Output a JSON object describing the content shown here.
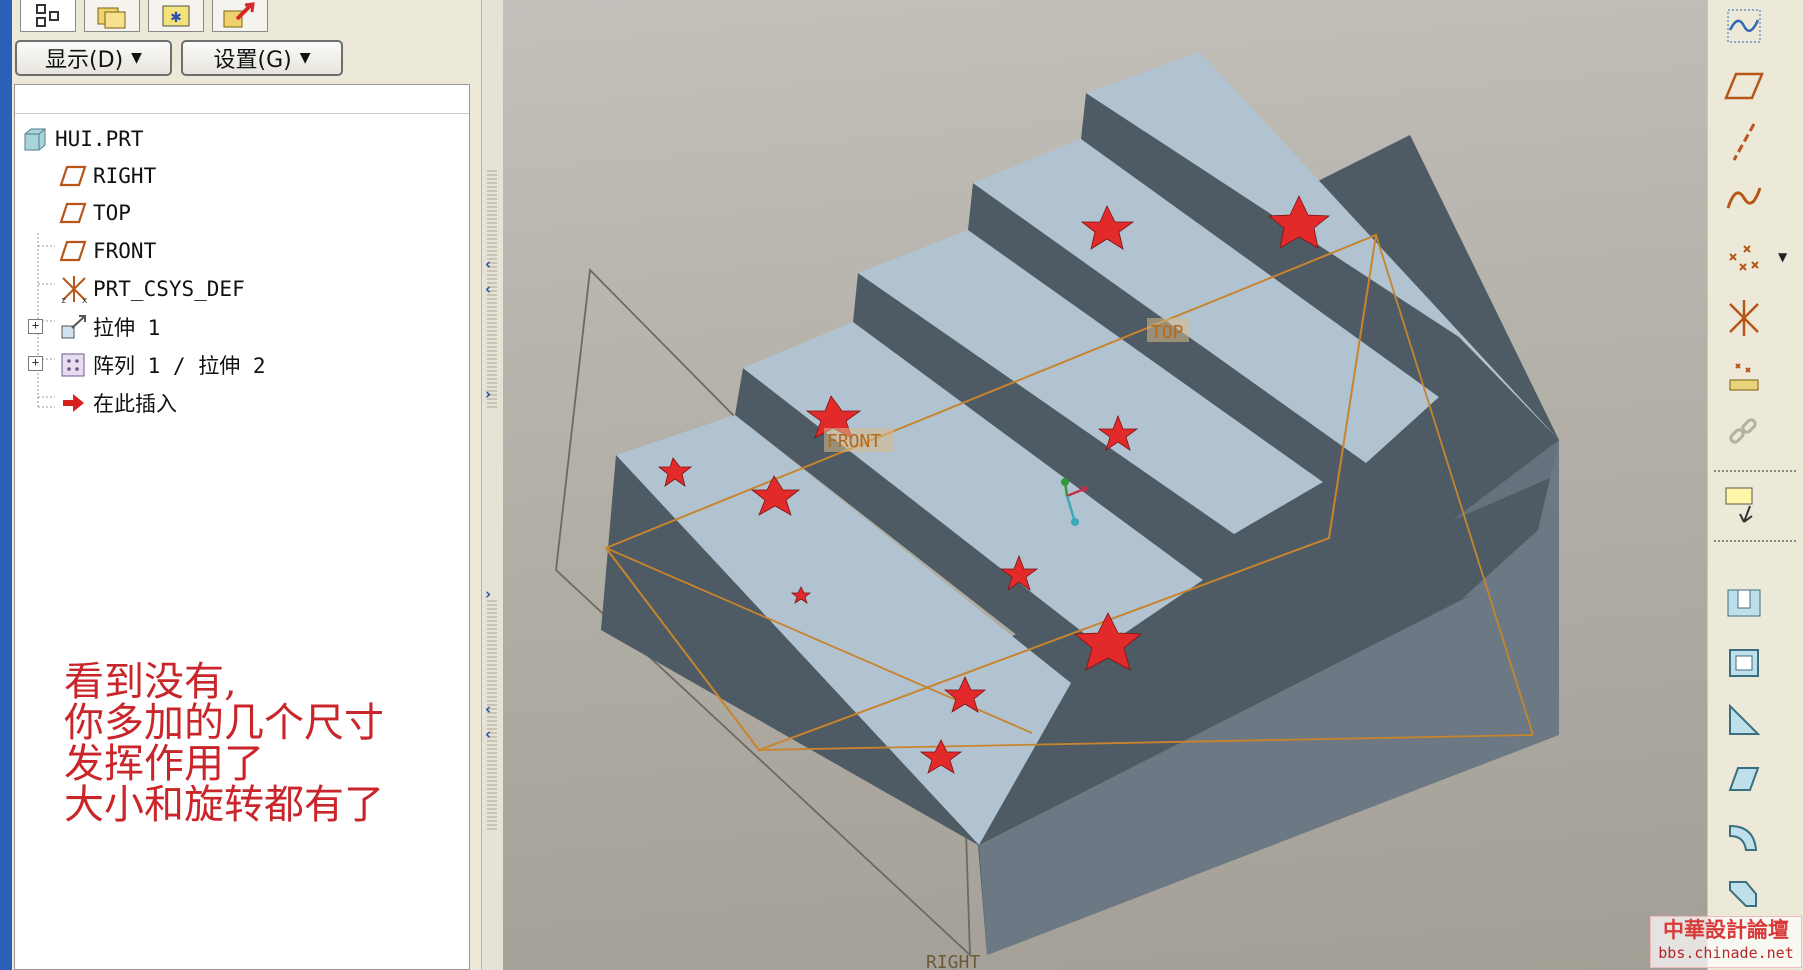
{
  "left_panel": {
    "dropdowns": [
      {
        "label": "显示(D)"
      },
      {
        "label": "设置(G)"
      }
    ],
    "tree": {
      "root": {
        "label": "HUI.PRT",
        "icon": "part-icon"
      },
      "items": [
        {
          "label": "RIGHT",
          "icon": "datum-plane-icon"
        },
        {
          "label": "TOP",
          "icon": "datum-plane-icon"
        },
        {
          "label": "FRONT",
          "icon": "datum-plane-icon"
        },
        {
          "label": "PRT_CSYS_DEF",
          "icon": "coordinate-system-icon"
        },
        {
          "label": "拉伸 1",
          "icon": "extrude-icon",
          "expandable": true
        },
        {
          "label": "阵列 1 / 拉伸 2",
          "icon": "pattern-icon",
          "expandable": true
        },
        {
          "label": "在此插入",
          "icon": "insert-here-arrow-icon"
        }
      ]
    }
  },
  "viewport": {
    "datum_labels": {
      "top": "TOP",
      "front": "FRONT",
      "right": "RIGHT"
    },
    "annotation_lines": [
      "看到没有,",
      "你多加的几个尺寸",
      "发挥作用了",
      "大小和旋转都有了"
    ],
    "colors": {
      "star": "#e22a2a",
      "step_top": "#b3c5d2",
      "step_riser": "#505c66",
      "datum_plane": "#c8842c"
    }
  },
  "right_toolbar": {
    "tools": [
      "sketched-datum-curve-icon",
      "datum-plane-icon",
      "datum-axis-icon",
      "datum-curve-icon",
      "datum-point-icon",
      "coordinate-system-icon",
      "analysis-feature-icon",
      "connect-icon",
      "sketch-tool-icon",
      "hole-icon",
      "shell-icon",
      "rib-icon",
      "draft-icon",
      "round-icon",
      "chamfer-icon"
    ]
  },
  "watermark": {
    "line1": "中華設計論壇",
    "line2": "bbs.chinade.net"
  }
}
